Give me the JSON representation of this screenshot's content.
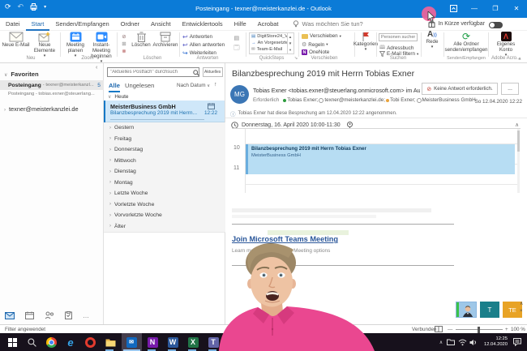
{
  "titlebar": {
    "title": "Posteingang - texner@meisterkanzlei.de - Outlook"
  },
  "menubar": {
    "tabs": [
      "Datei",
      "Start",
      "Senden/Empfangen",
      "Ordner",
      "Ansicht",
      "Entwicklertools",
      "Hilfe",
      "Acrobat"
    ],
    "tell_me": "Was möchten Sie tun?",
    "coming_soon": "In Kürze verfügbar"
  },
  "ribbon": {
    "neu": {
      "label": "Neu",
      "new_email": "Neue E-Mail",
      "new_items": "Neue Elemente"
    },
    "zoom": {
      "label": "Zoom",
      "plan": "Meeting planen",
      "instant": "Instant-Meeting beginnen"
    },
    "del": {
      "label": "Löschen",
      "delete": "Löschen",
      "archive": "Archivieren"
    },
    "respond": {
      "label": "Antworten",
      "reply": "Antworten",
      "reply_all": "Allen antworten",
      "forward": "Weiterleiten"
    },
    "quicksteps": {
      "label": "QuickSteps",
      "items": [
        "DigitStore24_Ve...",
        "An Vorgesetzte(n)",
        "Team-E-Mail"
      ]
    },
    "move": {
      "label": "Verschieben",
      "move": "Verschieben",
      "rules": "Regeln",
      "onenote": "OneNote"
    },
    "tags": {
      "categorize": "Kategorien"
    },
    "find": {
      "label": "Suchen",
      "people_placeholder": "Personen suchen",
      "address_book": "Adressbuch",
      "filter": "E-Mail filtern"
    },
    "speech": {
      "read": "Rede"
    },
    "sendreceive": {
      "label": "Senden/Empfangen",
      "send_all": "Alle Ordner senden/empfangen"
    },
    "adobe": {
      "label": "Adobe Acro...",
      "account": "Eigenes Konto"
    }
  },
  "folders": {
    "favorites": "Favoriten",
    "inbox1_name": "Posteingang",
    "inbox1_account": "- texner@meisterkanzl...",
    "inbox1_count": "5",
    "inbox2": "Posteingang - tobias.exner@steuerlang...",
    "account": "texner@meisterkanzlei.de"
  },
  "list": {
    "search_placeholder": "\"Aktuelles Postfach\" durchsuch",
    "scope": "Aktuelles Postfach",
    "tab_all": "Alle",
    "tab_unread": "Ungelesen",
    "sort": "Nach Datum",
    "today": "Heute",
    "mail": {
      "sender": "MeisterBusiness GmbH",
      "subject": "Bilanzbesprechung 2019 mit Herrn...",
      "time": "12:22"
    },
    "groups": [
      "Gestern",
      "Freitag",
      "Donnerstag",
      "Mittwoch",
      "Dienstag",
      "Montag",
      "Letzte Woche",
      "Vorletzte Woche",
      "Vorvorletzte Woche",
      "Älter"
    ]
  },
  "mail": {
    "subject": "Bilanzbesprechung 2019 mit Herrn Tobias Exner",
    "avatar": "MG",
    "from": "Tobias Exner <tobias.exner@steuerlang.onmicrosoft.com> im Auftrag",
    "required": "Erforderlich",
    "rcpt1": "Tobias Exner;",
    "rcpt2": "texner@meisterkanzlei.de;",
    "rcpt3": "Tobi Exner;",
    "rcpt4": "MeisterBusiness GmbH",
    "no_response": "Keine Antwort erforderlich.",
    "more": "...",
    "date": "So 12.04.2020 12:22",
    "accepted": "Tobias Exner hat diese Besprechung am 12.04.2020 12:22 angenommen.",
    "meeting_time": "Donnerstag, 16. April 2020 10:00-11:30",
    "hour1": "10",
    "hour2": "11",
    "event_title": "Bilanzbesprechung 2019 mit Herrn Tobias Exner",
    "event_org": "MeisterBusiness GmbH",
    "teams_link": "Join Microsoft Teams Meeting",
    "teams_more": "Learn more about Teams | Meeting options"
  },
  "statusbar": {
    "filter": "Filter angewendet",
    "connected": "Verbunden",
    "zoom": "100 %"
  },
  "taskbar": {
    "time": "12:25",
    "date": "12.04.2020"
  },
  "overlay": {
    "thumb2": "T",
    "thumb3": "TE"
  }
}
